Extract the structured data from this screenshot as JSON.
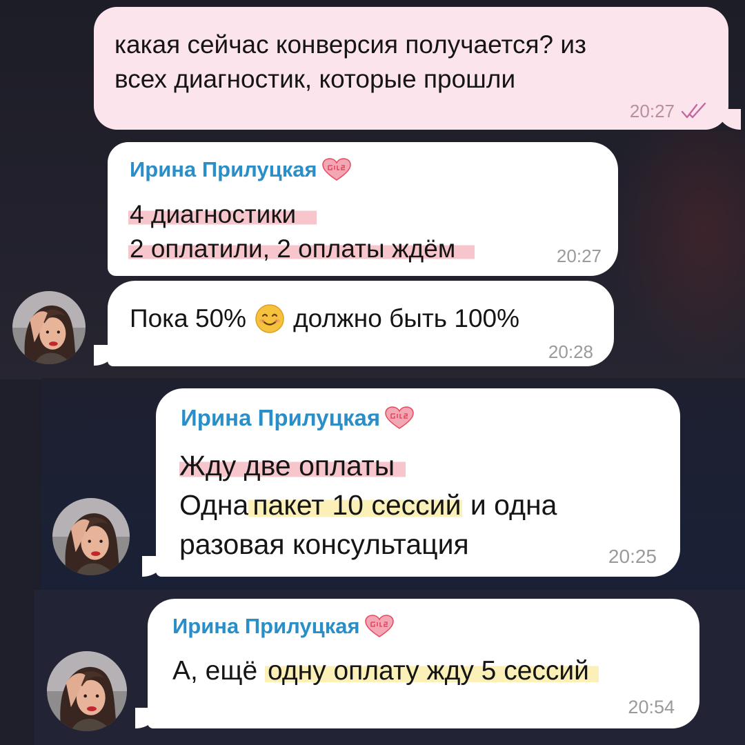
{
  "chat": {
    "messages": [
      {
        "direction": "outgoing",
        "lines": [
          "какая сейчас конверсия получается? из",
          "всех диагностик, которые прошли"
        ],
        "time": "20:27",
        "read_icon": "double-check-icon"
      },
      {
        "direction": "incoming",
        "sender": "Ирина Прилуцкая",
        "badge": "GiRL POWER",
        "lines": [
          "4 диагностики",
          "2 оплатили, 2 оплаты ждём"
        ],
        "time": "20:27"
      },
      {
        "direction": "incoming",
        "text_before": "Пока 50%",
        "emoji": "smiling-face-emoji",
        "text_after": "должно быть 100%",
        "time": "20:28"
      },
      {
        "direction": "incoming",
        "sender": "Ирина Прилуцкая",
        "badge": "GiRL POWER",
        "line1": "Жду две оплаты",
        "line2_prefix": "Одна",
        "line2_highlight": "пакет 10 сессий",
        "line2_suffix": "и одна",
        "line3": "разовая консультация",
        "time": "20:25"
      },
      {
        "direction": "incoming",
        "sender": "Ирина Прилуцкая",
        "badge": "GiRL POWER",
        "text_prefix": "А, ещё",
        "text_highlight": "одну оплату жду 5 сессий",
        "time": "20:54"
      }
    ]
  },
  "colors": {
    "outgoing_bubble": "#fce4ec",
    "incoming_bubble": "#ffffff",
    "sender_name": "#2a8ec9",
    "highlight_pink": "#f7c6cc",
    "highlight_yellow": "#fbf1b8",
    "read_check": "#c06aa0",
    "badge": "#e5485f"
  }
}
